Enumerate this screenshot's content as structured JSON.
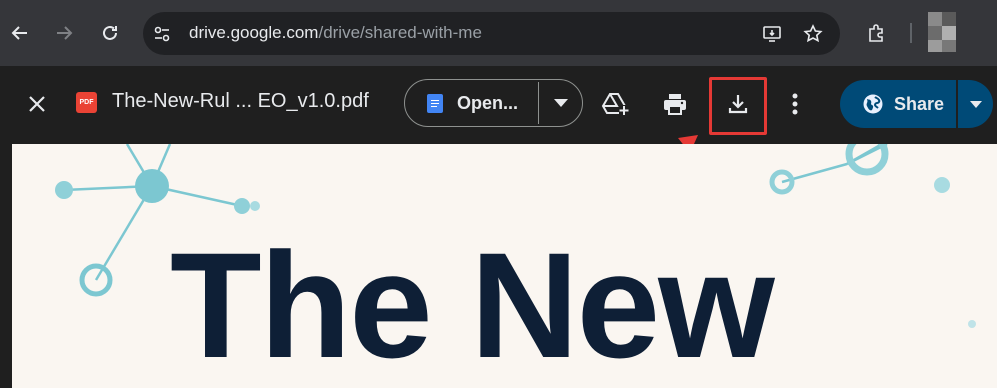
{
  "browser": {
    "url_host": "drive.google.com",
    "url_path": "/drive/shared-with-me",
    "back_icon": "arrow-left-icon",
    "forward_icon": "arrow-right-icon",
    "reload_icon": "reload-icon"
  },
  "viewer": {
    "file_title": "The-New-Rul ... EO_v1.0.pdf",
    "file_type_badge": "PDF",
    "open_with_label": "Open...",
    "share_label": "Share"
  },
  "document": {
    "heading": "The New"
  },
  "colors": {
    "accent_share": "#004a77",
    "highlight": "#e53935",
    "page_bg": "#faf6f1",
    "heading_text": "#0e1f36",
    "network_nodes": "#7cc7d1"
  }
}
